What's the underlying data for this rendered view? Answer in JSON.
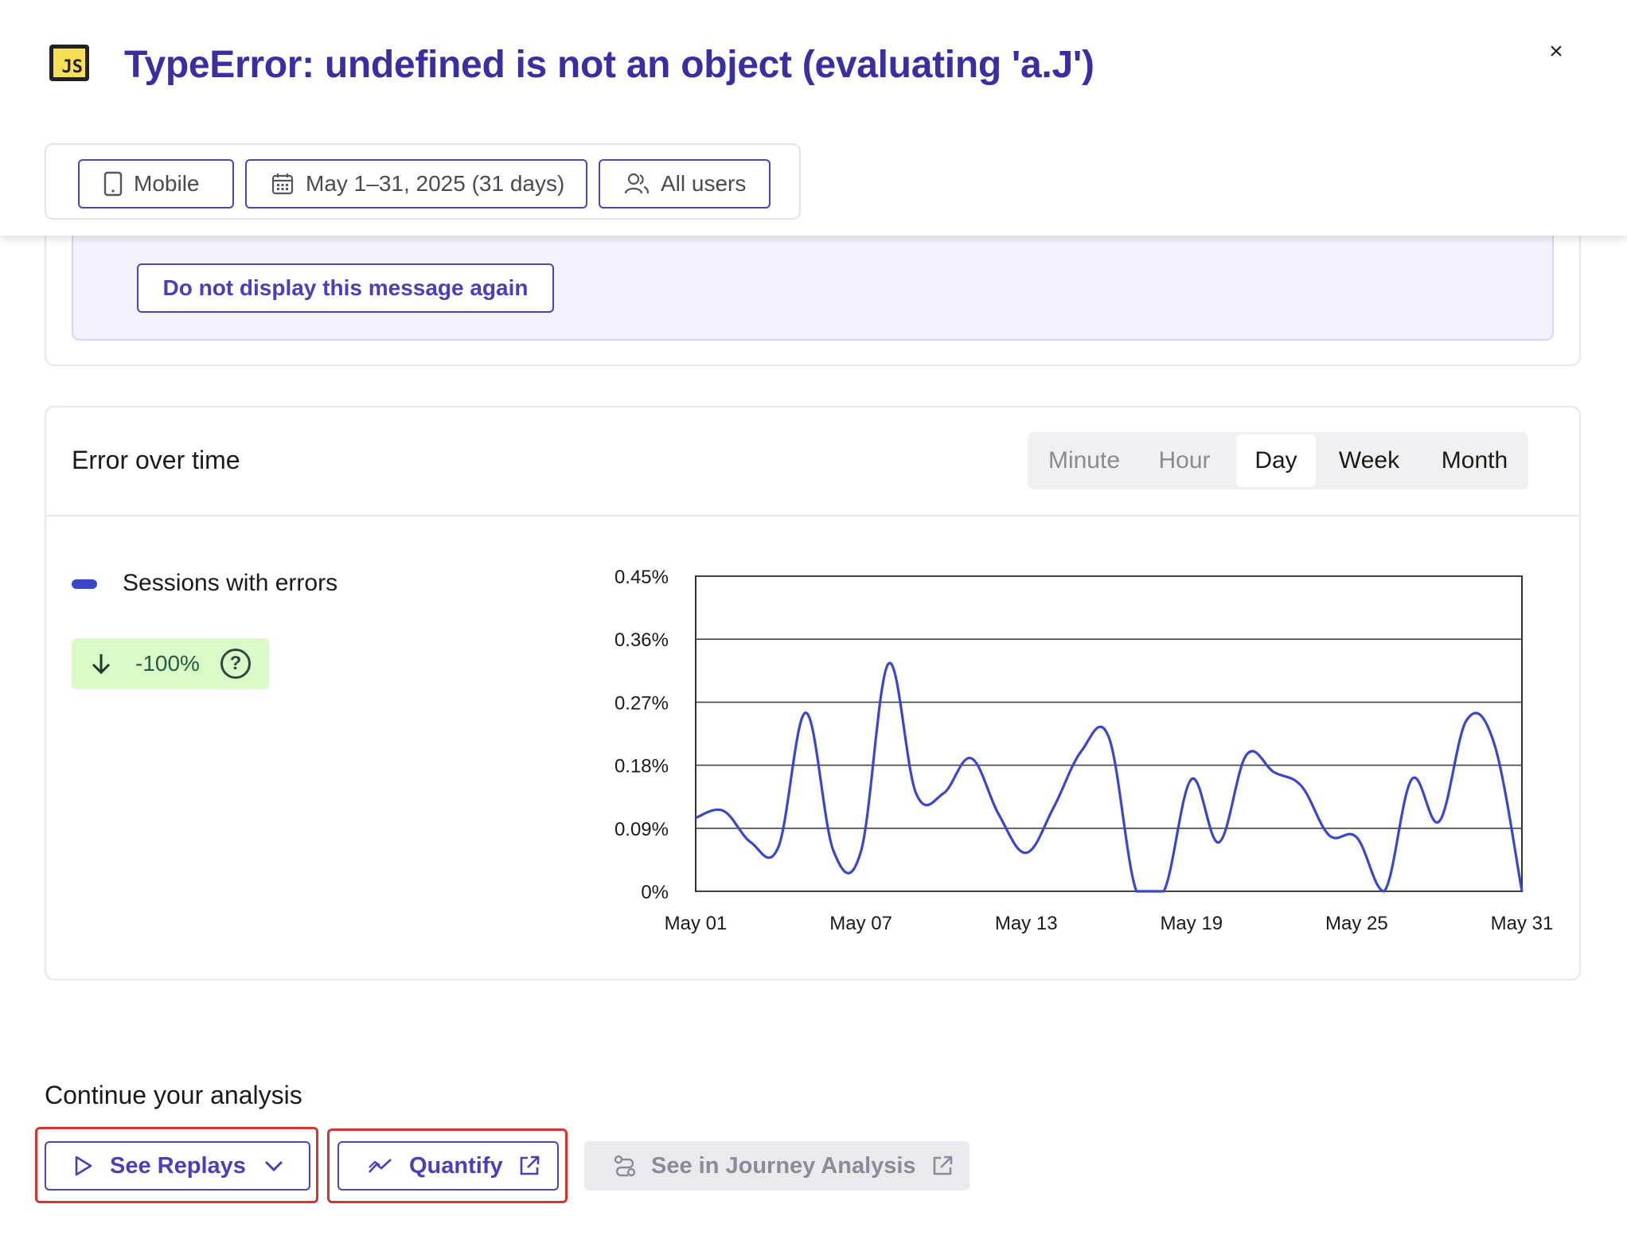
{
  "header": {
    "logo_text": "JS",
    "title": "TypeError: undefined is not an object (evaluating 'a.J')",
    "close_glyph": "×"
  },
  "filters": {
    "device": {
      "label": "Mobile",
      "icon": "mobile-icon"
    },
    "date": {
      "label": "May 1–31, 2025 (31 days)",
      "icon": "calendar-icon"
    },
    "users": {
      "label": "All users",
      "icon": "users-icon"
    }
  },
  "message": {
    "dismiss_label": "Do not display this message again"
  },
  "error_chart": {
    "title": "Error over time",
    "granularity": {
      "options": [
        "Minute",
        "Hour",
        "Day",
        "Week",
        "Month"
      ],
      "selected": "Day"
    },
    "legend_label": "Sessions with errors",
    "trend_value": "-100%",
    "help_glyph": "?"
  },
  "chart_data": {
    "type": "line",
    "x": [
      "May 01",
      "May 02",
      "May 03",
      "May 04",
      "May 05",
      "May 06",
      "May 07",
      "May 08",
      "May 09",
      "May 10",
      "May 11",
      "May 12",
      "May 13",
      "May 14",
      "May 15",
      "May 16",
      "May 17",
      "May 18",
      "May 19",
      "May 20",
      "May 21",
      "May 22",
      "May 23",
      "May 24",
      "May 25",
      "May 26",
      "May 27",
      "May 28",
      "May 29",
      "May 30",
      "May 31"
    ],
    "x_tick_labels": [
      "May 01",
      "May 07",
      "May 13",
      "May 19",
      "May 25",
      "May 31"
    ],
    "series": [
      {
        "name": "Sessions with errors",
        "color": "#3b47c6",
        "values": [
          0.105,
          0.115,
          0.07,
          0.063,
          0.255,
          0.058,
          0.057,
          0.325,
          0.14,
          0.14,
          0.19,
          0.11,
          0.055,
          0.12,
          0.2,
          0.22,
          0.0,
          0.0,
          0.16,
          0.07,
          0.195,
          0.17,
          0.15,
          0.08,
          0.077,
          0.0,
          0.16,
          0.1,
          0.245,
          0.21,
          0.0
        ]
      }
    ],
    "y_tick_labels": [
      "0%",
      "0.09%",
      "0.18%",
      "0.27%",
      "0.36%",
      "0.45%"
    ],
    "ylim": [
      0,
      0.45
    ],
    "grid": true
  },
  "continue": {
    "title": "Continue your analysis",
    "replays_label": "See Replays",
    "quantify_label": "Quantify",
    "journey_label": "See in Journey Analysis",
    "highlight_color": "#d8342f"
  }
}
